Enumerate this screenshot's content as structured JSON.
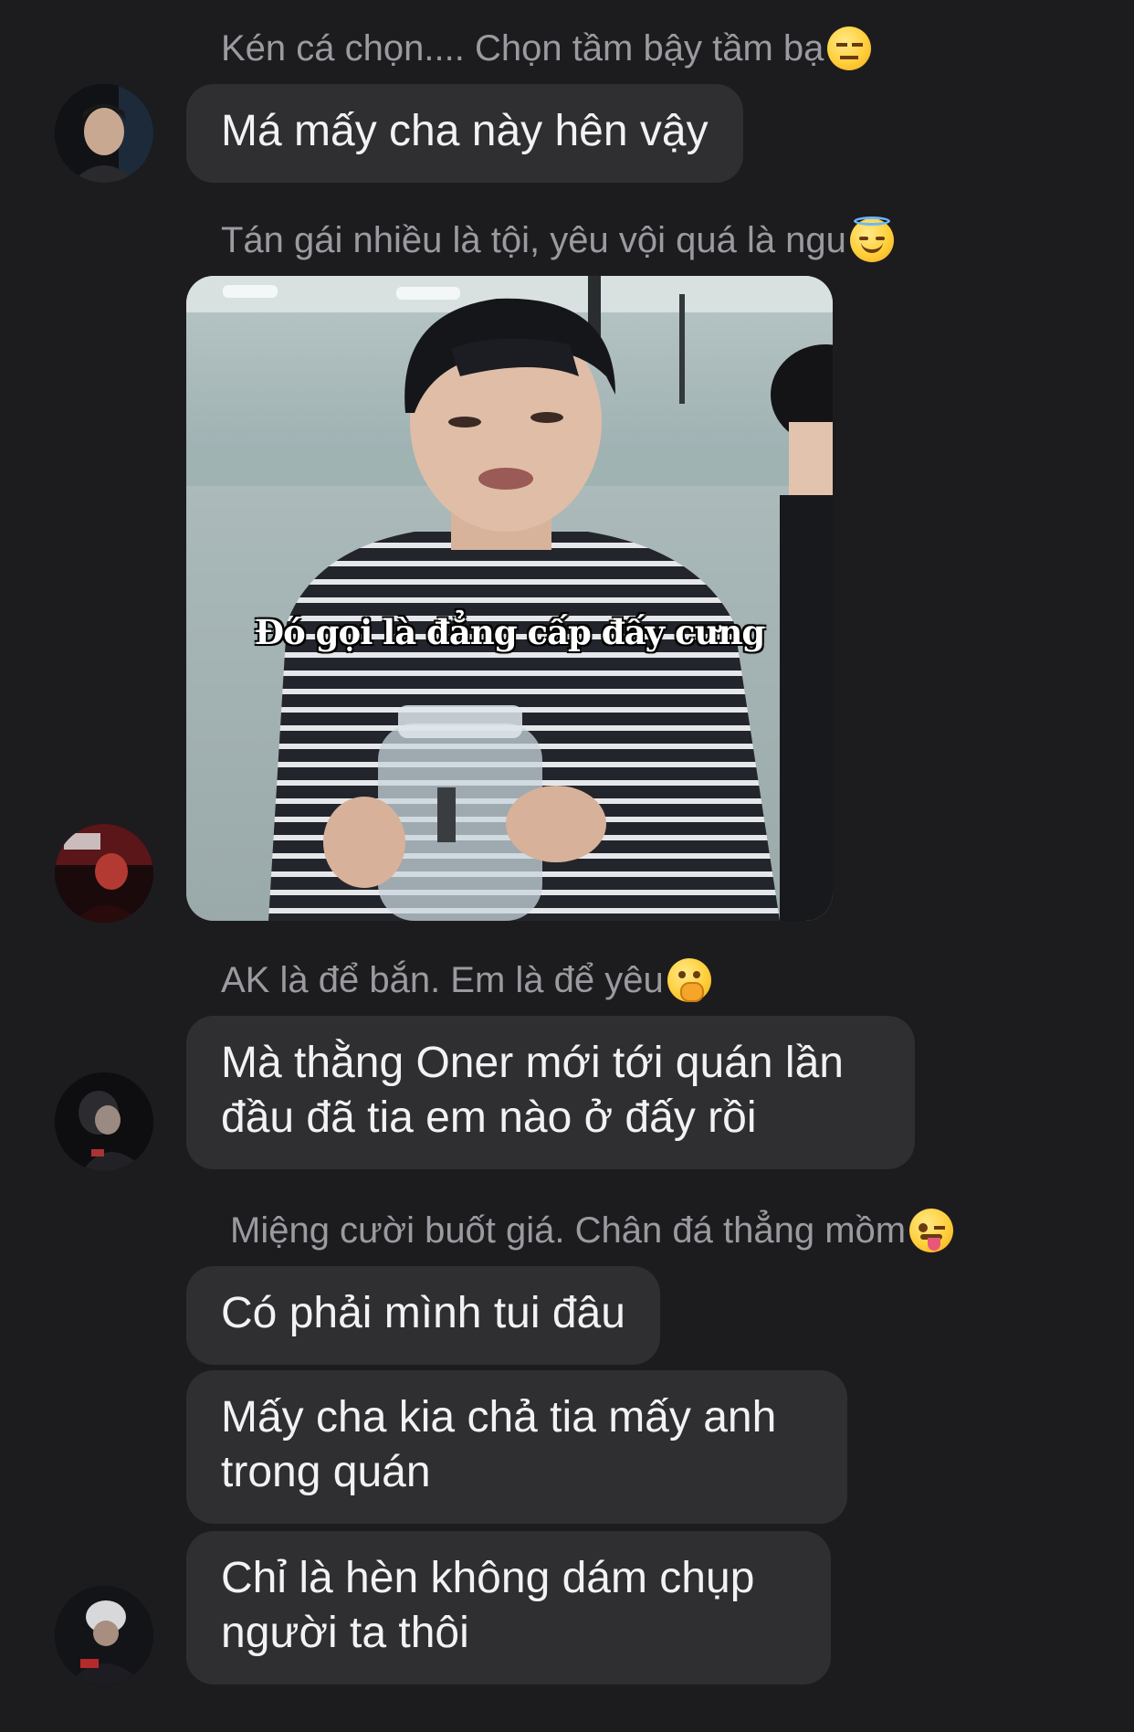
{
  "messages": [
    {
      "sender": "Kén cá chọn.... Chọn tầm bậy tầm bạ",
      "sender_emoji": "expressionless-face",
      "text": "Má mấy cha này hên vậy"
    },
    {
      "sender": "Tán gái nhiều là tội, yêu vội quá là ngu",
      "sender_emoji": "smiling-face-with-halo",
      "image_caption": "Đó gọi là đẳng cấp đấy cưng"
    },
    {
      "sender": "AK là để bắn. Em là để yêu",
      "sender_emoji": "face-with-hand-over-mouth",
      "text": "Mà thằng Oner mới tới quán lần đầu đã tia em nào ở đấy rồi"
    },
    {
      "sender": "Miệng cười buốt giá. Chân đá thẳng mồm",
      "sender_emoji": "winking-face-with-tongue",
      "texts": [
        "Có phải mình tui đâu",
        "Mấy cha kia chả tia mấy anh trong quán",
        "Chỉ là hèn không dám chụp người ta thôi"
      ]
    }
  ]
}
